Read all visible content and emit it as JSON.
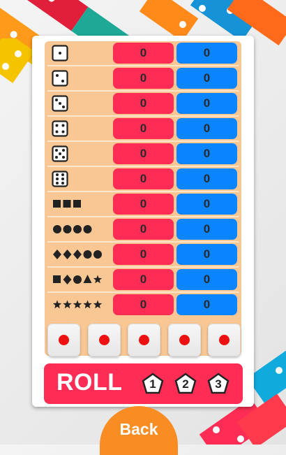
{
  "scorecard": {
    "rows": [
      {
        "category_icon": "die-face-1-icon",
        "red": "0",
        "blue": "0"
      },
      {
        "category_icon": "die-face-2-icon",
        "red": "0",
        "blue": "0"
      },
      {
        "category_icon": "die-face-3-icon",
        "red": "0",
        "blue": "0"
      },
      {
        "category_icon": "die-face-4-icon",
        "red": "0",
        "blue": "0"
      },
      {
        "category_icon": "die-face-5-icon",
        "red": "0",
        "blue": "0"
      },
      {
        "category_icon": "die-face-6-icon",
        "red": "0",
        "blue": "0"
      },
      {
        "category_icon": "three-squares-icon",
        "red": "0",
        "blue": "0"
      },
      {
        "category_icon": "four-circles-icon",
        "red": "0",
        "blue": "0"
      },
      {
        "category_icon": "two-diamonds-three-circles-icon",
        "red": "0",
        "blue": "0"
      },
      {
        "category_icon": "mixed-shapes-icon",
        "red": "0",
        "blue": "0"
      },
      {
        "category_icon": "five-stars-icon",
        "red": "0",
        "blue": "0"
      }
    ]
  },
  "dice": [
    {
      "face": 1,
      "held": false
    },
    {
      "face": 1,
      "held": false
    },
    {
      "face": 1,
      "held": false
    },
    {
      "face": 1,
      "held": false
    },
    {
      "face": 1,
      "held": false
    }
  ],
  "roll": {
    "label": "ROLL",
    "turns": [
      "1",
      "2",
      "3"
    ]
  },
  "back_label": "Back",
  "colors": {
    "red_player": "#ff2d55",
    "blue_player": "#0a84ff",
    "table_bg": "#f9c794",
    "back_button": "#fa8c24"
  }
}
